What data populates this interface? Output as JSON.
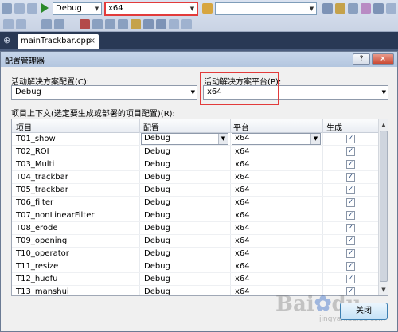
{
  "ide": {
    "toolbar": {
      "config_combo": "Debug",
      "platform_combo": "x64"
    },
    "tab_title": "mainTrackbar.cpp",
    "tab_close": "×"
  },
  "dialog": {
    "title": "配置管理器",
    "help_btn": "?",
    "close_btn": "×",
    "active_config_label": "活动解决方案配置(C):",
    "active_config_value": "Debug",
    "active_platform_label": "活动解决方案平台(P):",
    "active_platform_value": "x64",
    "context_label": "项目上下文(选定要生成或部署的项目配置)(R):",
    "columns": [
      "项目",
      "配置",
      "平台",
      "生成"
    ],
    "rows": [
      {
        "project": "T01_show",
        "config": "Debug",
        "platform": "x64",
        "build": true
      },
      {
        "project": "T02_ROI",
        "config": "Debug",
        "platform": "x64",
        "build": true
      },
      {
        "project": "T03_Multi",
        "config": "Debug",
        "platform": "x64",
        "build": true
      },
      {
        "project": "T04_trackbar",
        "config": "Debug",
        "platform": "x64",
        "build": true
      },
      {
        "project": "T05_trackbar",
        "config": "Debug",
        "platform": "x64",
        "build": true
      },
      {
        "project": "T06_filter",
        "config": "Debug",
        "platform": "x64",
        "build": true
      },
      {
        "project": "T07_nonLinearFilter",
        "config": "Debug",
        "platform": "x64",
        "build": true
      },
      {
        "project": "T08_erode",
        "config": "Debug",
        "platform": "x64",
        "build": true
      },
      {
        "project": "T09_opening",
        "config": "Debug",
        "platform": "x64",
        "build": true
      },
      {
        "project": "T10_operator",
        "config": "Debug",
        "platform": "x64",
        "build": true
      },
      {
        "project": "T11_resize",
        "config": "Debug",
        "platform": "x64",
        "build": true
      },
      {
        "project": "T12_huofu",
        "config": "Debug",
        "platform": "x64",
        "build": true
      },
      {
        "project": "T13_manshui",
        "config": "Debug",
        "platform": "x64",
        "build": true
      }
    ],
    "close_button": "关闭"
  },
  "watermark": {
    "logo": "Bai du",
    "sub": "jingyan.baidu.com"
  },
  "colors": {
    "highlight": "#e23b3b",
    "ide_dark": "#293955"
  }
}
